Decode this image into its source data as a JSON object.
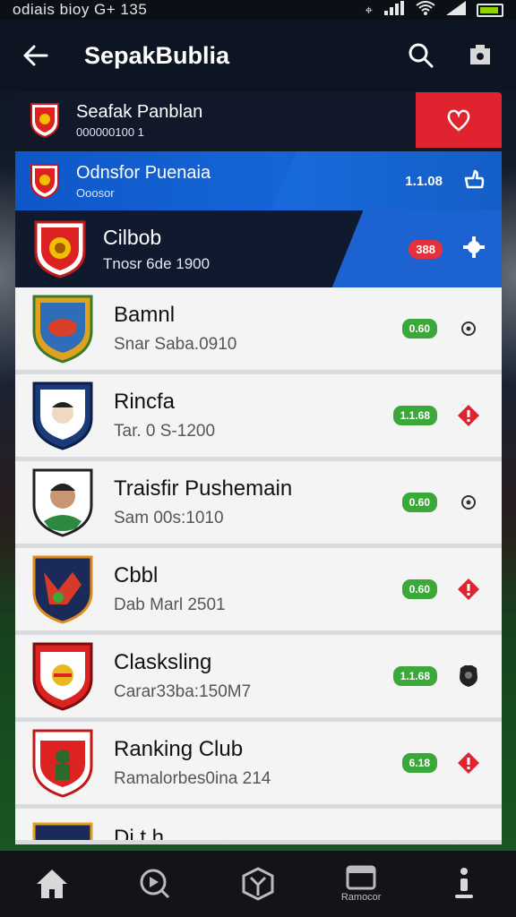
{
  "status_bar": {
    "left_text": "odiais bioy G+ 135"
  },
  "app_bar": {
    "title": "SepakBublia"
  },
  "featured": [
    {
      "title": "Seafak Panblan",
      "subtitle": "000000100 1"
    },
    {
      "title": "Odnsfor Puenaia",
      "subtitle": "Ooosor",
      "badge": "1.1.08"
    },
    {
      "title": "Cilbob",
      "subtitle": "Tnosr 6de 1900",
      "badge": "388"
    }
  ],
  "rows": [
    {
      "title": "Bamnl",
      "subtitle": "Snar Saba.0910",
      "badge": "0.60",
      "action_icon": "settings-icon"
    },
    {
      "title": "Rincfa",
      "subtitle": "Tar. 0 S-1200",
      "badge": "1.1.68",
      "action_icon": "alert-icon"
    },
    {
      "title": "Traisfir Pushemain",
      "subtitle": "Sam 00s:1010",
      "badge": "0.60",
      "action_icon": "settings-icon"
    },
    {
      "title": "Cbbl",
      "subtitle": "Dab Marl 2501",
      "badge": "0.60",
      "action_icon": "alert-icon"
    },
    {
      "title": "Clasksling",
      "subtitle": "Carar33ba:150M7",
      "badge": "1.1.68",
      "action_icon": "shield-icon"
    },
    {
      "title": "Ranking Club",
      "subtitle": "Ramalorbes0ina 214",
      "badge": "6.18",
      "action_icon": "alert-icon"
    }
  ],
  "partial_row": {
    "title": "Di  t  h"
  },
  "bottom_nav": [
    {
      "icon": "home-icon",
      "label": ""
    },
    {
      "icon": "video-icon",
      "label": ""
    },
    {
      "icon": "shield-icon",
      "label": ""
    },
    {
      "icon": "folder-icon",
      "label": "Ramocor"
    },
    {
      "icon": "more-icon",
      "label": ""
    }
  ],
  "colors": {
    "accent_blue": "#1565d8",
    "accent_red": "#e0242f",
    "badge_green": "#3aa93a"
  }
}
